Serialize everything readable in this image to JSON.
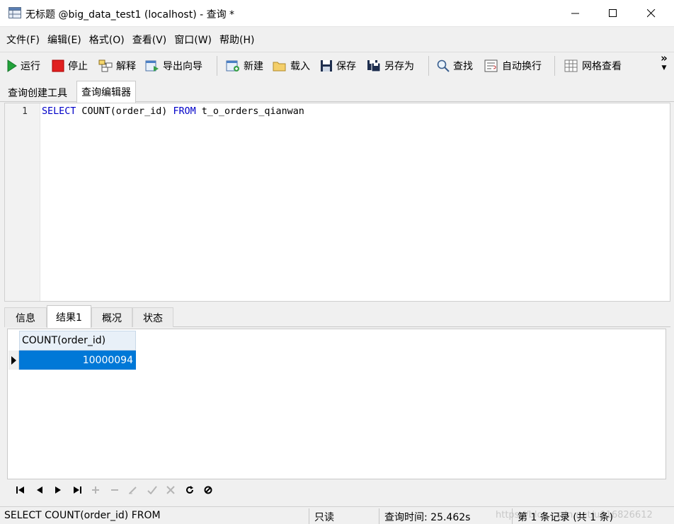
{
  "window": {
    "title": "无标题 @big_data_test1 (localhost) - 查询 *"
  },
  "menu": [
    "文件(F)",
    "编辑(E)",
    "格式(O)",
    "查看(V)",
    "窗口(W)",
    "帮助(H)"
  ],
  "toolbar": {
    "run": "运行",
    "stop": "停止",
    "explain": "解释",
    "export_wizard": "导出向导",
    "new": "新建",
    "load": "载入",
    "save": "保存",
    "save_as": "另存为",
    "find": "查找",
    "word_wrap": "自动换行",
    "grid_view": "网格查看",
    "overflow": "»"
  },
  "editor_tabs": [
    "查询创建工具",
    "查询编辑器"
  ],
  "editor": {
    "line_number": "1",
    "code_keyword1": "SELECT",
    "code_middle": " COUNT(order_id) ",
    "code_keyword2": "FROM",
    "code_rest": " t_o_orders_qianwan"
  },
  "result_tabs": [
    "信息",
    "结果1",
    "概况",
    "状态"
  ],
  "results": {
    "column": "COUNT(order_id)",
    "value": "10000094"
  },
  "status": {
    "sql": "SELECT COUNT(order_id) FROM",
    "mode": "只读",
    "query_time": "查询时间: 25.462s",
    "record": "第 1 条记录 (共 1 条)",
    "watermark": "https://blog.csdn.net/u016826612"
  },
  "colors": {
    "keyword": "#0000c8",
    "selection": "#0078d7",
    "header": "#e8f0f8"
  }
}
